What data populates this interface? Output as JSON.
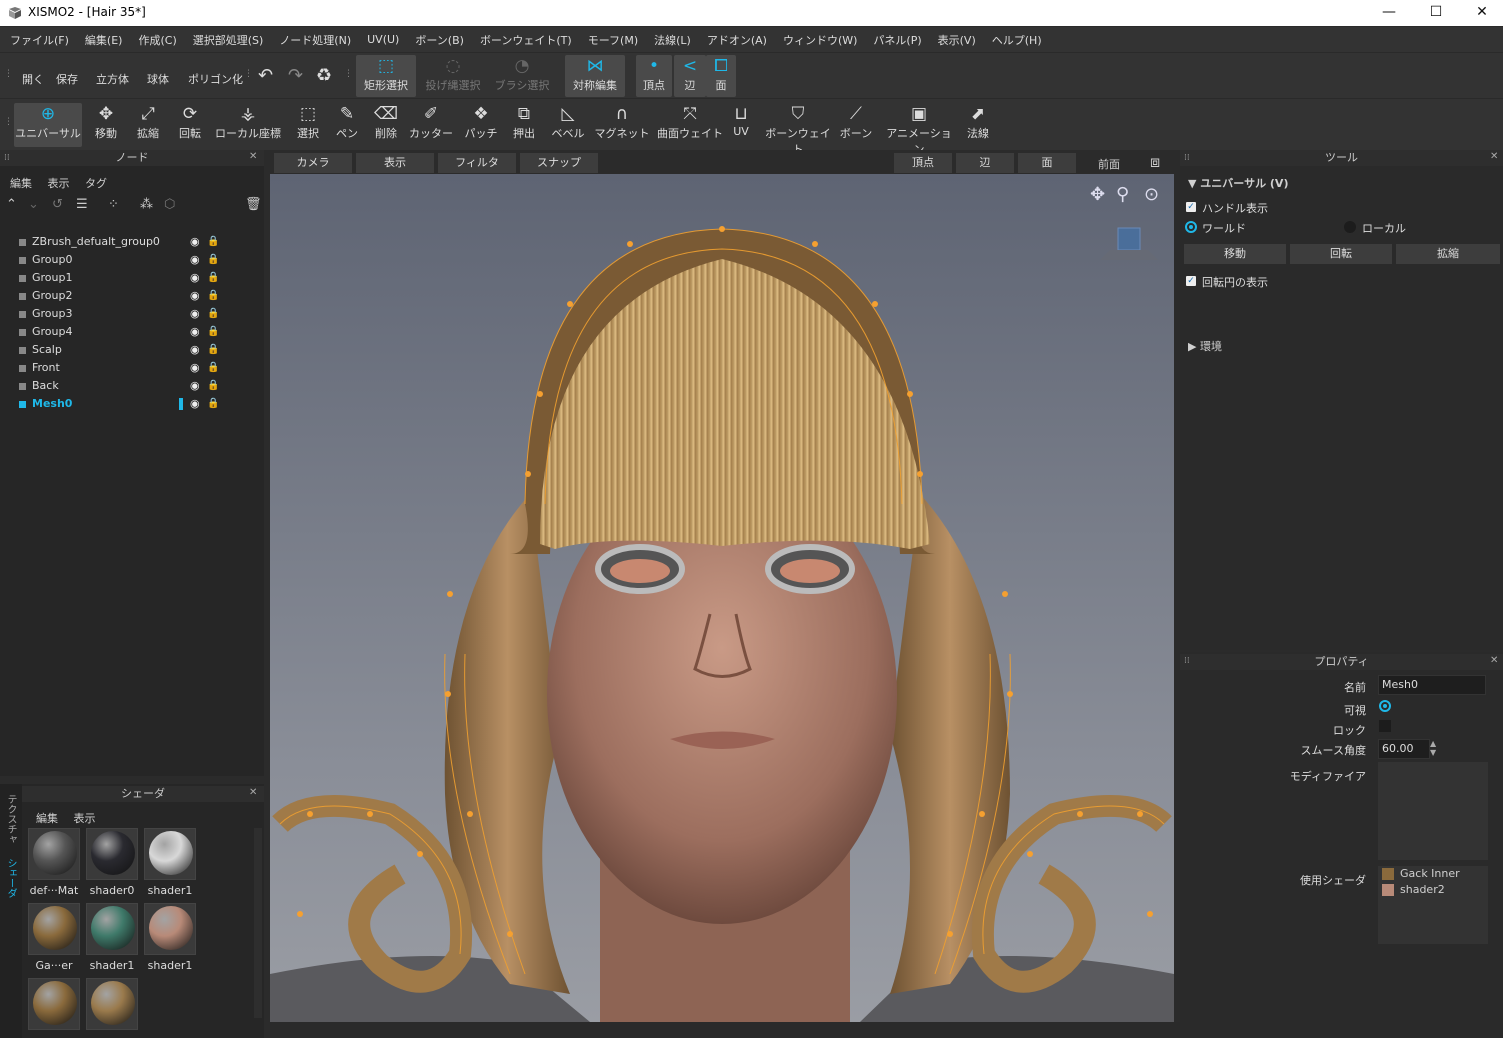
{
  "window": {
    "title": "XISMO2 - [Hair 35*]",
    "minimize": "—",
    "maximize": "☐",
    "close": "✕"
  },
  "menu": [
    "ファイル(F)",
    "編集(E)",
    "作成(C)",
    "選択部処理(S)",
    "ノード処理(N)",
    "UV(U)",
    "ボーン(B)",
    "ボーンウェイト(T)",
    "モーフ(M)",
    "法線(L)",
    "アドオン(A)",
    "ウィンドウ(W)",
    "パネル(P)",
    "表示(V)",
    "ヘルプ(H)"
  ],
  "toolbar1": {
    "open": "開く",
    "save": "保存",
    "cube": "立方体",
    "sphere": "球体",
    "polygonize": "ポリゴン化",
    "rect_select": "矩形選択",
    "lasso_select": "投げ縄選択",
    "brush_select": "ブラシ選択",
    "symmetry_edit": "対称編集",
    "vertex": "頂点",
    "edge": "辺",
    "face": "面"
  },
  "toolbar2": [
    {
      "label": "ユニバーサル",
      "icon": "globe-icon",
      "glyph": "⊕"
    },
    {
      "label": "移動",
      "icon": "move-icon",
      "glyph": "✥"
    },
    {
      "label": "拡縮",
      "icon": "scale-icon",
      "glyph": "⤢"
    },
    {
      "label": "回転",
      "icon": "rotate-icon",
      "glyph": "⟳"
    },
    {
      "label": "ローカル座標",
      "icon": "local-axis-icon",
      "glyph": "⚶"
    },
    {
      "label": "選択",
      "icon": "select-icon",
      "glyph": "⬚"
    },
    {
      "label": "ペン",
      "icon": "pen-icon",
      "glyph": "✎"
    },
    {
      "label": "削除",
      "icon": "erase-icon",
      "glyph": "⌫"
    },
    {
      "label": "カッター",
      "icon": "cutter-icon",
      "glyph": "✐"
    },
    {
      "label": "パッチ",
      "icon": "patch-icon",
      "glyph": "❖"
    },
    {
      "label": "押出",
      "icon": "extrude-icon",
      "glyph": "⧉"
    },
    {
      "label": "ベベル",
      "icon": "bevel-icon",
      "glyph": "◺"
    },
    {
      "label": "マグネット",
      "icon": "magnet-icon",
      "glyph": "∩"
    },
    {
      "label": "曲面ウェイト",
      "icon": "curve-weight-icon",
      "glyph": "⤧"
    },
    {
      "label": "UV",
      "icon": "uv-icon",
      "glyph": "⊔"
    },
    {
      "label": "ボーンウェイト",
      "icon": "bone-weight-icon",
      "glyph": "⛉"
    },
    {
      "label": "ボーン",
      "icon": "bone-icon",
      "glyph": "⟋"
    },
    {
      "label": "アニメーション",
      "icon": "animation-icon",
      "glyph": "▣"
    },
    {
      "label": "法線",
      "icon": "normal-icon",
      "glyph": "⬈"
    }
  ],
  "node_panel": {
    "title": "ノード",
    "menu": [
      "編集",
      "表示",
      "タグ"
    ],
    "nodes": [
      "ZBrush_defualt_group0",
      "Group0",
      "Group1",
      "Group2",
      "Group3",
      "Group4",
      "Scalp",
      "Front",
      "Back",
      "Mesh0"
    ],
    "selected": "Mesh0"
  },
  "shader_panel": {
    "title": "シェーダ",
    "menu": [
      "編集",
      "表示"
    ],
    "side_tabs": [
      "テクスチャ",
      "シェーダ"
    ],
    "shaders": [
      {
        "label": "def···Mat",
        "color": "#555555"
      },
      {
        "label": "shader0",
        "color": "#2a2a30"
      },
      {
        "label": "shader1",
        "color": "#d8d8d8"
      },
      {
        "label": "Ga···er",
        "color": "#8a6a3c"
      },
      {
        "label": "shader1",
        "color": "#3f7a6a"
      },
      {
        "label": "shader1",
        "color": "#b88a78"
      },
      {
        "label": "",
        "color": "#8a6a3c"
      },
      {
        "label": "",
        "color": "#9a7a4c"
      }
    ]
  },
  "viewport_bar": {
    "camera": "カメラ",
    "display": "表示",
    "filter": "フィルタ",
    "snap": "スナップ",
    "vertex": "頂点",
    "edge": "辺",
    "face": "面",
    "front": "前面"
  },
  "tool_panel": {
    "title": "ツール",
    "section": "ユニバーサル (V)",
    "handle_display": "ハンドル表示",
    "world": "ワールド",
    "local": "ローカル",
    "move": "移動",
    "rotate": "回転",
    "scale": "拡縮",
    "show_rotation_circle": "回転円の表示",
    "environment": "環境"
  },
  "property_panel": {
    "title": "プロパティ",
    "name_label": "名前",
    "name_value": "Mesh0",
    "visible_label": "可視",
    "lock_label": "ロック",
    "smooth_label": "スムース角度",
    "smooth_value": "60.00",
    "modifier_label": "モディファイア",
    "shader_label": "使用シェーダ",
    "shaders_used": [
      "Gack Inner",
      "shader2"
    ]
  },
  "colors": {
    "accent": "#1fb8e8",
    "wire": "#f0a030"
  }
}
